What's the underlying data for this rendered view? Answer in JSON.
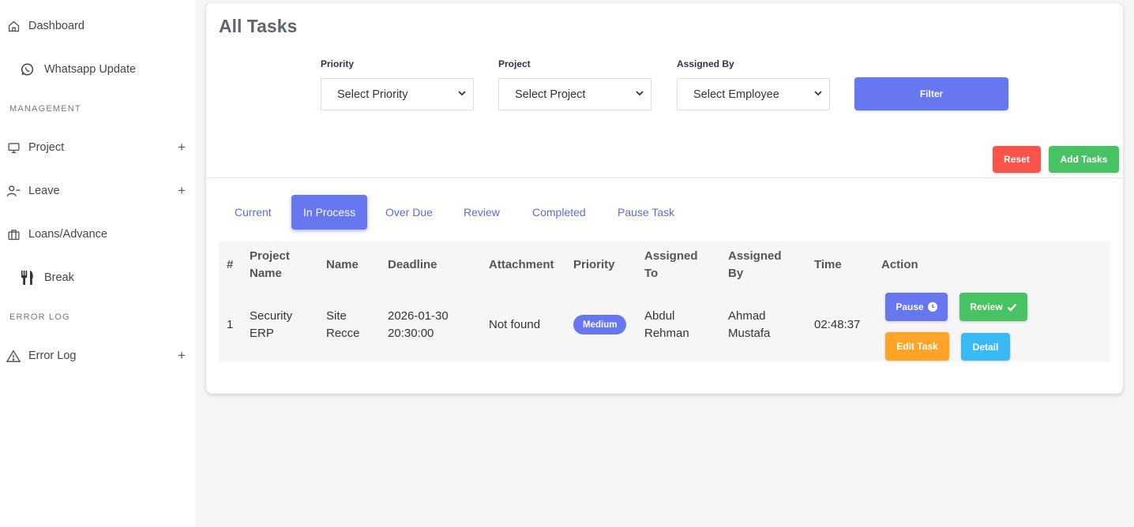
{
  "sidebar": {
    "items": [
      {
        "label": "Dashboard",
        "icon": "home-icon"
      },
      {
        "label": "Whatsapp Update",
        "icon": "whatsapp-icon"
      },
      {
        "label": "Project",
        "icon": "monitor-icon"
      },
      {
        "label": "Leave",
        "icon": "user-minus-icon"
      },
      {
        "label": "Loans/Advance",
        "icon": "briefcase-icon"
      },
      {
        "label": "Break",
        "icon": "utensils-icon"
      },
      {
        "label": "Error Log",
        "icon": "warning-icon"
      }
    ],
    "sections": {
      "management": "MANAGEMENT",
      "error_log": "ERROR LOG"
    },
    "expand_symbol": "+"
  },
  "page": {
    "title": "All Tasks"
  },
  "filters": {
    "priority": {
      "label": "Priority",
      "value": "Select Priority"
    },
    "project": {
      "label": "Project",
      "value": "Select Project"
    },
    "assigned_by": {
      "label": "Assigned By",
      "value": "Select Employee"
    },
    "filter_button": "Filter"
  },
  "actions": {
    "reset": "Reset",
    "add_tasks": "Add Tasks"
  },
  "tabs": [
    "Current",
    "In Process",
    "Over Due",
    "Review",
    "Completed",
    "Pause Task"
  ],
  "active_tab": "In Process",
  "table": {
    "headers": {
      "num": "#",
      "project_name": [
        "Project",
        "Name"
      ],
      "name": "Name",
      "deadline": "Deadline",
      "attachment": "Attachment",
      "priority": "Priority",
      "assigned_to": [
        "Assigned",
        "To"
      ],
      "assigned_by": [
        "Assigned",
        "By"
      ],
      "time": "Time",
      "action": "Action"
    },
    "rows": [
      {
        "num": "1",
        "project_name": [
          "Security",
          "ERP"
        ],
        "name": [
          "Site",
          "Recce"
        ],
        "deadline": [
          "2026-01-30",
          "20:30:00"
        ],
        "attachment": "Not found",
        "priority": "Medium",
        "assigned_to": [
          "Abdul",
          "Rehman"
        ],
        "assigned_by": [
          "Ahmad",
          "Mustafa"
        ],
        "time": "02:48:37",
        "buttons": {
          "pause": "Pause",
          "review": "Review",
          "edit": "Edit Task",
          "detail": "Detail"
        }
      }
    ]
  },
  "colors": {
    "primary": "#6777ef",
    "success": "#47c363",
    "danger": "#fc544b",
    "warning": "#ffa426",
    "info": "#3abaf4"
  }
}
